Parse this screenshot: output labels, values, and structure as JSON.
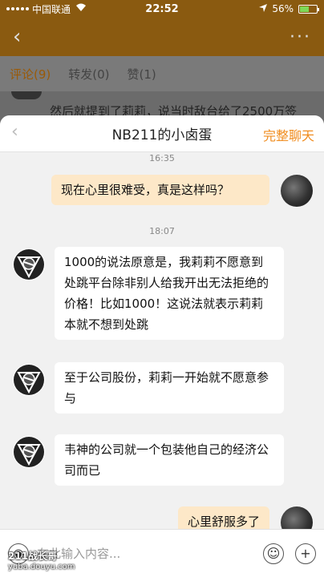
{
  "status": {
    "carrier": "中国联通",
    "time": "22:52",
    "battery": "56%"
  },
  "background_app": {
    "tabs": [
      {
        "label": "评论(9)"
      },
      {
        "label": "转发(0)"
      },
      {
        "label": "赞(1)"
      }
    ],
    "peek_text": "然后就提到了莉莉，说当时敌台给了2500万签"
  },
  "chat": {
    "title": "NB211的小卤蛋",
    "full_chat_label": "完整聊天",
    "messages": [
      {
        "timestamp": "16:35"
      },
      {
        "side": "right",
        "text": "现在心里很难受，真是这样吗？"
      },
      {
        "timestamp": "18:07"
      },
      {
        "side": "left",
        "text": "1000的说法原意是，我莉莉不愿意到处跳平台除非别人给我开出无法拒绝的价格！比如1000！这说法就表示莉莉本就不想到处跳"
      },
      {
        "side": "left",
        "text": "至于公司股份，莉莉一开始就不愿意参与"
      },
      {
        "side": "left",
        "text": "韦神的公司就一个包装他自己的经济公司而已"
      },
      {
        "side": "right",
        "text": "心里舒服多了"
      }
    ]
  },
  "input": {
    "placeholder": "在此输入内容..."
  },
  "watermark": {
    "line1": "211战长哥",
    "line2": "yuba.douyu.com"
  },
  "colors": {
    "accent": "#f08c1e",
    "right_bubble": "#fde8c8"
  }
}
